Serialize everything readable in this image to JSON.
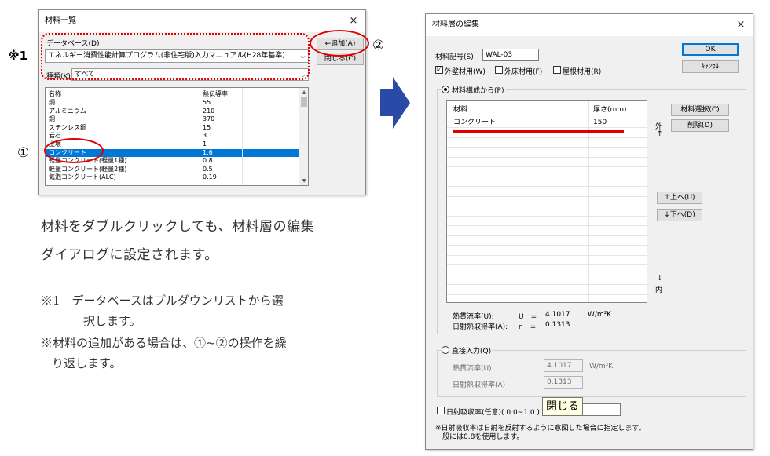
{
  "left_dialog": {
    "title": "材料一覧",
    "close": "×",
    "database_label": "データベース(D)",
    "database_value": "エネルギー消費性能計算プログラム(非住宅版)入力マニュアル(H28年基準)",
    "type_label": "種類(K)",
    "type_value": "すべて",
    "add_button": "←追加(A)",
    "close_button": "閉じる(C)",
    "columns": [
      "名称",
      "熱伝導率"
    ],
    "rows": [
      {
        "name": "鋼",
        "value": "55"
      },
      {
        "name": "アルミニウム",
        "value": "210"
      },
      {
        "name": "銅",
        "value": "370"
      },
      {
        "name": "ステンレス鋼",
        "value": "15"
      },
      {
        "name": "岩石",
        "value": "3.1"
      },
      {
        "name": "土壌",
        "value": "1"
      },
      {
        "name": "コンクリート",
        "value": "1.6"
      },
      {
        "name": "軽量コンクリート(軽量1種)",
        "value": "0.8"
      },
      {
        "name": "軽量コンクリート(軽量2種)",
        "value": "0.5"
      },
      {
        "name": "気泡コンクリート(ALC)",
        "value": "0.19"
      }
    ],
    "selected_index": 6
  },
  "annotations": {
    "mark_note1": "※1",
    "circle1": "①",
    "circle2": "②",
    "main_text_line1": "材料をダブルクリックしても、材料層の編集",
    "main_text_line2": "ダイアログに設定されます。",
    "note1_line1": "※1　データベースはプルダウンリストから選",
    "note1_line2": "択します。",
    "note2_line1": "※材料の追加がある場合は、①~②の操作を繰",
    "note2_line2": "り返します。"
  },
  "right_dialog": {
    "title": "材料層の編集",
    "close": "×",
    "code_label": "材料記号(S)",
    "code_value": "WAL-03",
    "ok": "OK",
    "cancel": "ｷｬﾝｾﾙ",
    "check_exterior": "外壁材用(W)",
    "check_floor": "外床材用(F)",
    "check_roof": "屋根材用(R)",
    "check_exterior_mark": "☑",
    "radio_composition": "材料構成から(P)",
    "table_columns": [
      "材料",
      "厚さ(mm)"
    ],
    "table_rows": [
      {
        "material": "コンクリート",
        "thickness": "150"
      }
    ],
    "select_material": "材料選択(C)",
    "delete": "削除(D)",
    "outside": "外",
    "inside": "内",
    "arrow_up": "↑",
    "arrow_down": "↓",
    "move_up": "↑上へ(U)",
    "move_down": "↓下へ(D)",
    "u_label": "熱貫流率(U):",
    "u_symbol": "U　=",
    "u_value": "4.1017",
    "u_unit": "W/m²K",
    "eta_label": "日射熱取得率(A):",
    "eta_symbol": "η　=",
    "eta_value": "0.1313",
    "radio_direct": "直接入力(Q)",
    "direct_u_label": "熱貫流率(U)",
    "direct_u_value": "4.1017",
    "direct_u_unit": "W/m²K",
    "direct_eta_label": "日射熱取得率(A)",
    "direct_eta_value": "0.1313",
    "absorb_label": "日射吸収率(任意)( 0.0~1.0 ):",
    "tooltip": "閉じる",
    "footer_line1": "※日射吸収率は日射を反射するように意図した場合に指定します。",
    "footer_line2": "一般には0.8を使用します。"
  },
  "colors": {
    "annotation_red": "#e00000",
    "arrow_blue": "#2a4aa8",
    "selection_blue": "#0078d7"
  }
}
